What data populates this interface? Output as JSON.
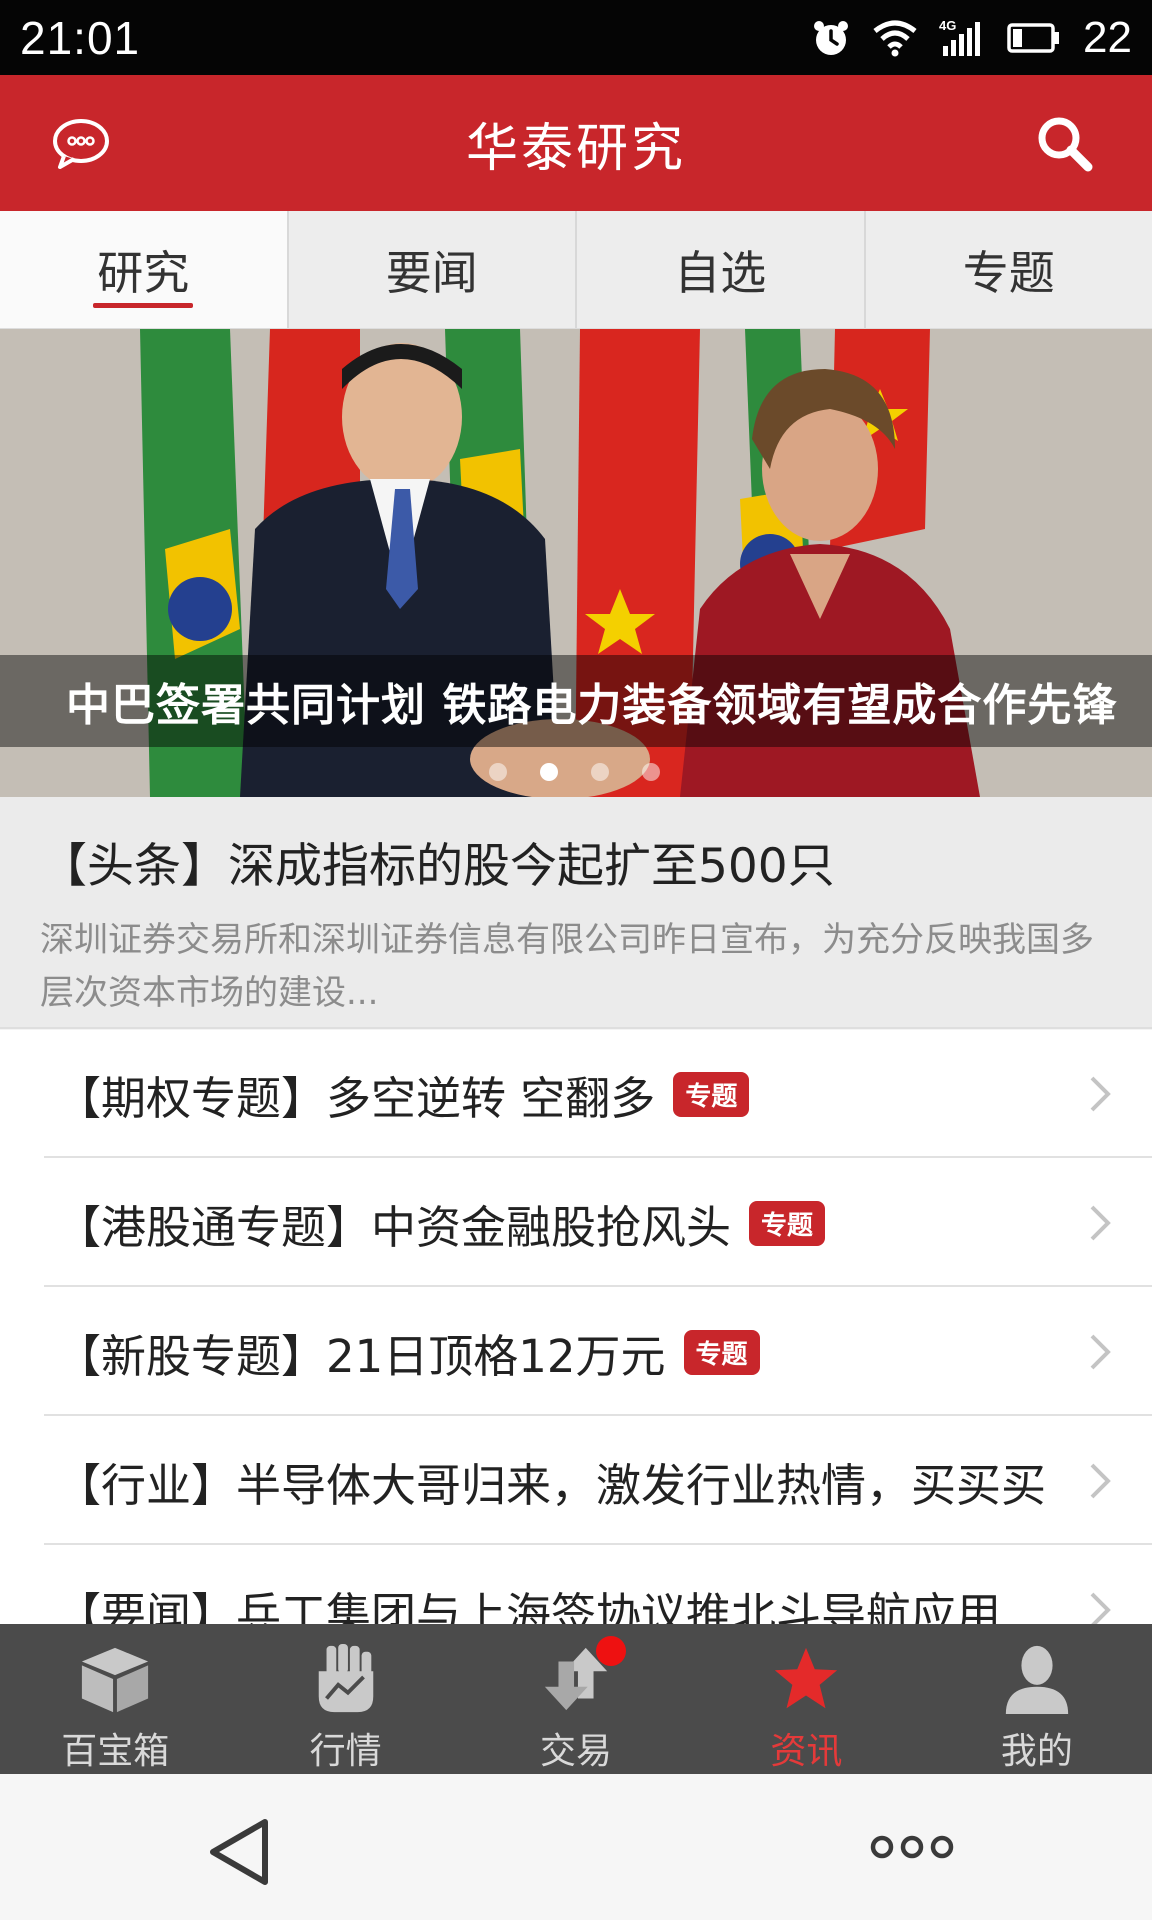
{
  "status_bar": {
    "time": "21:01",
    "battery": "22"
  },
  "app_bar": {
    "title": "华泰研究"
  },
  "tabs": [
    {
      "label": "研究",
      "active": true
    },
    {
      "label": "要闻",
      "active": false
    },
    {
      "label": "自选",
      "active": false
    },
    {
      "label": "专题",
      "active": false
    }
  ],
  "banner": {
    "caption": "中巴签署共同计划  铁路电力装备领域有望成合作先锋",
    "slide_count": 4,
    "active_slide": 2
  },
  "headline": {
    "title": "【头条】深成指标的股今起扩至500只",
    "description": "深圳证券交易所和深圳证券信息有限公司昨日宣布，为充分反映我国多层次资本市场的建设..."
  },
  "list": [
    {
      "text": "【期权专题】多空逆转 空翻多",
      "badge": "专题"
    },
    {
      "text": "【港股通专题】中资金融股抢风头",
      "badge": "专题"
    },
    {
      "text": "【新股专题】21日顶格12万元",
      "badge": "专题"
    },
    {
      "text": "【行业】半导体大哥归来，激发行业热情，买买买",
      "badge": ""
    },
    {
      "text": "【要闻】兵工集团与上海签协议推北斗导航应用 ...",
      "badge": ""
    }
  ],
  "bottom_nav": [
    {
      "label": "百宝箱",
      "icon": "box-icon",
      "active": false
    },
    {
      "label": "行情",
      "icon": "market-hand-icon",
      "active": false
    },
    {
      "label": "交易",
      "icon": "trade-arrows-icon",
      "active": false,
      "notification_dot": true
    },
    {
      "label": "资讯",
      "icon": "star-icon",
      "active": true
    },
    {
      "label": "我的",
      "icon": "person-icon",
      "active": false
    }
  ],
  "colors": {
    "brand_red": "#c8262b",
    "nav_bg": "#4b4b4b",
    "active_nav": "#e43a3a"
  }
}
